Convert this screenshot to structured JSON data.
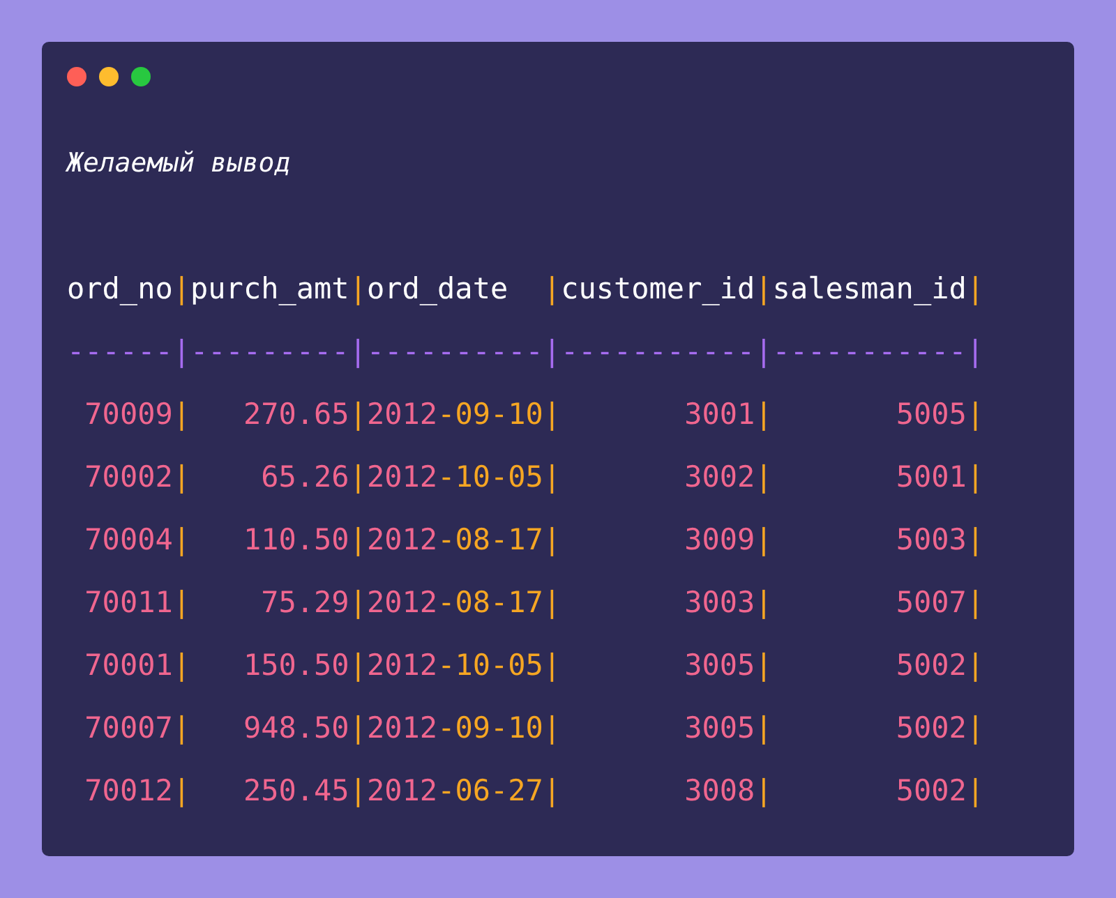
{
  "window": {
    "controls": [
      {
        "color": "#fe5f57"
      },
      {
        "color": "#febc2e"
      },
      {
        "color": "#28c840"
      }
    ]
  },
  "title": "Желаемый вывод",
  "lines": [
    {
      "kind": "header",
      "text": "ord_no|purch_amt|ord_date  |customer_id|salesman_id|"
    },
    {
      "kind": "separator",
      "text": "------|---------|----------|-----------|-----------|"
    },
    {
      "kind": "data",
      "text": " 70009|   270.65|2012-09-10|       3001|       5005|"
    },
    {
      "kind": "data",
      "text": " 70002|    65.26|2012-10-05|       3002|       5001|"
    },
    {
      "kind": "data",
      "text": " 70004|   110.50|2012-08-17|       3009|       5003|"
    },
    {
      "kind": "data",
      "text": " 70011|    75.29|2012-08-17|       3003|       5007|"
    },
    {
      "kind": "data",
      "text": " 70001|   150.50|2012-10-05|       3005|       5002|"
    },
    {
      "kind": "data",
      "text": " 70007|   948.50|2012-09-10|       3005|       5002|"
    },
    {
      "kind": "data",
      "text": " 70012|   250.45|2012-06-27|       3008|       5002|"
    }
  ]
}
